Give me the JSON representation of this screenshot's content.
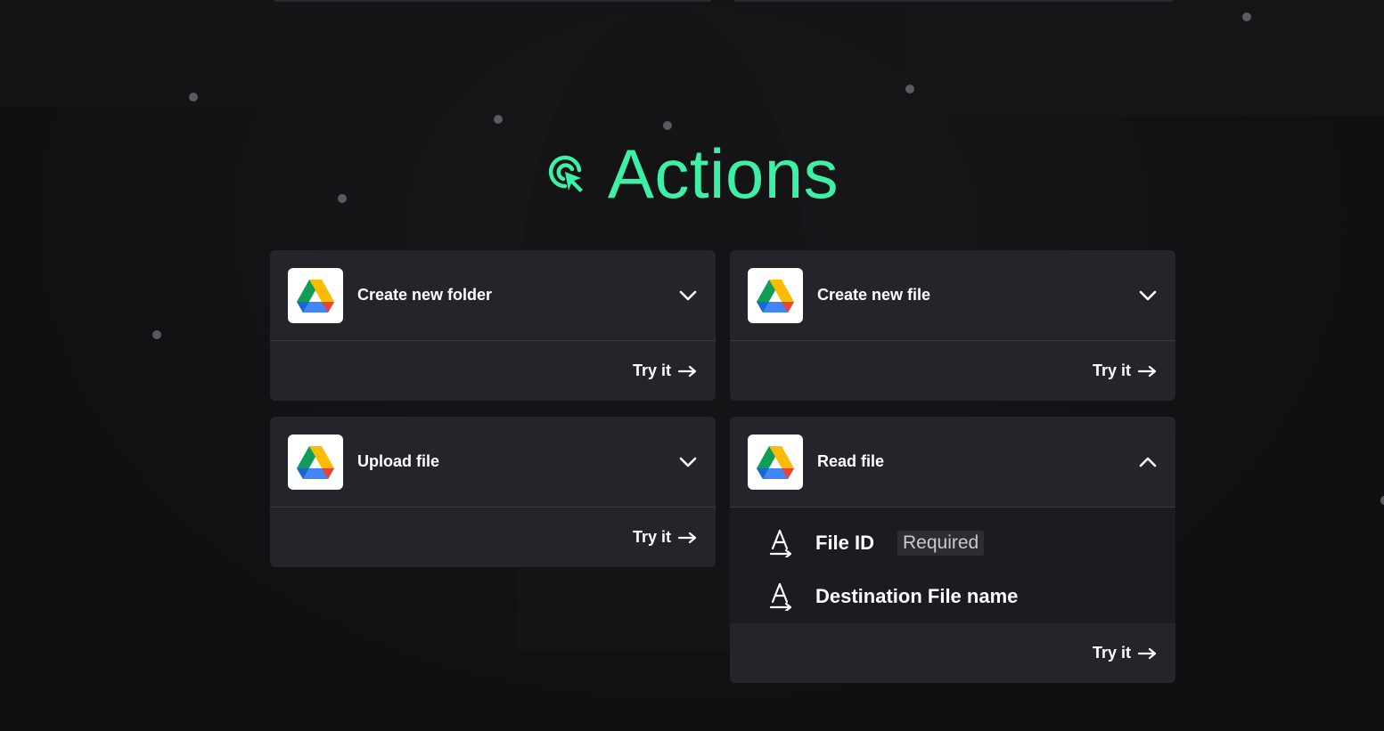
{
  "title": "Actions",
  "accent_color": "#3ef0a5",
  "icons": {
    "title": "cursor-click-icon",
    "card_logo": "google-drive-icon",
    "expand": "chevron-down-icon",
    "collapse": "chevron-up-icon",
    "arrow": "arrow-right-icon",
    "param": "text-input-icon"
  },
  "cards": [
    {
      "title": "Create new folder",
      "try_label": "Try it",
      "expanded": false
    },
    {
      "title": "Create new file",
      "try_label": "Try it",
      "expanded": false
    },
    {
      "title": "Upload file",
      "try_label": "Try it",
      "expanded": false
    },
    {
      "title": "Read file",
      "try_label": "Try it",
      "expanded": true,
      "params": [
        {
          "name": "File ID",
          "badge": "Required"
        },
        {
          "name": "Destination File name"
        }
      ]
    }
  ]
}
